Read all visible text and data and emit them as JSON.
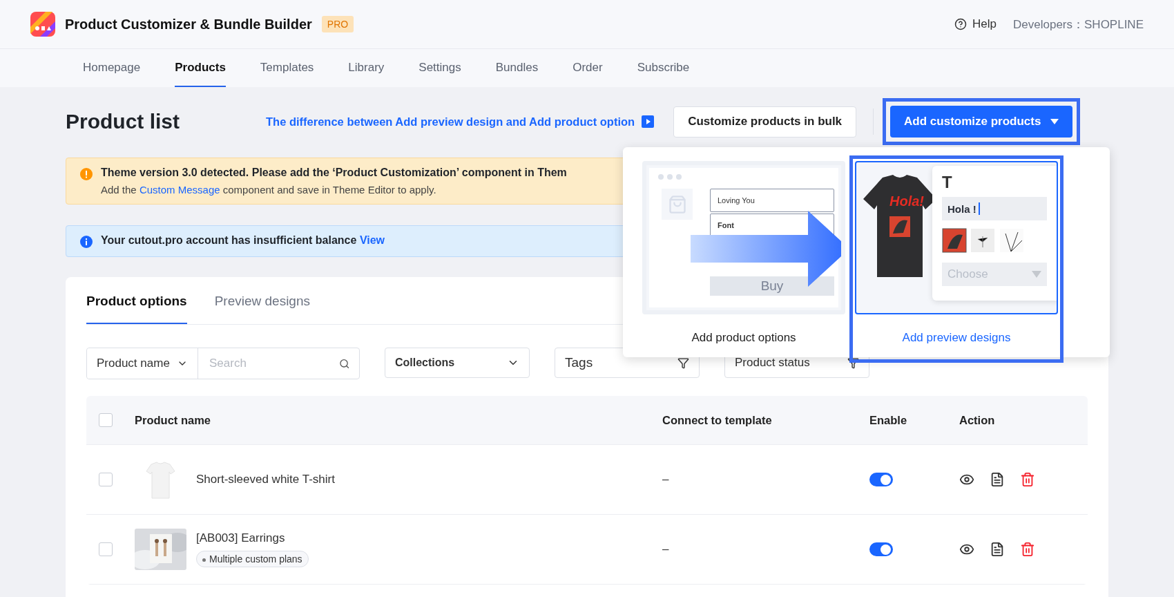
{
  "app": {
    "title": "Product Customizer & Bundle Builder",
    "badge": "PRO",
    "help": "Help",
    "developer": "Developers：SHOPLINE"
  },
  "nav": [
    {
      "label": "Homepage",
      "selected": false
    },
    {
      "label": "Products",
      "selected": true
    },
    {
      "label": "Templates",
      "selected": false
    },
    {
      "label": "Library",
      "selected": false
    },
    {
      "label": "Settings",
      "selected": false
    },
    {
      "label": "Bundles",
      "selected": false
    },
    {
      "label": "Order",
      "selected": false
    },
    {
      "label": "Subscribe",
      "selected": false
    }
  ],
  "page": {
    "title": "Product list",
    "help_link": "The difference between Add preview design and Add product option",
    "bulk_button": "Customize products in bulk",
    "add_button": {
      "label": "Add customize products",
      "highlighted": true
    }
  },
  "dropdown": {
    "options": [
      {
        "kind": "options",
        "label": "Add product options",
        "highlighted": false,
        "mock": {
          "field_1": "Loving You",
          "field_2": "Font",
          "button": "Buy"
        }
      },
      {
        "kind": "preview",
        "label": "Add preview designs",
        "highlighted": true,
        "mock": {
          "shirt_text": "Hola!",
          "heading": "T",
          "input": "Hola !",
          "select": "Choose"
        }
      }
    ]
  },
  "alerts": [
    {
      "kind": "warning",
      "title": "Theme version 3.0 detected. Please add the ‘Product Customization’ component in Them",
      "before": "Add the ",
      "link": "Custom Message",
      "after": " component and save in Theme Editor to apply."
    },
    {
      "kind": "info",
      "title": "Your cutout.pro account has insufficient balance",
      "link": "View"
    }
  ],
  "tabs": [
    {
      "label": "Product options",
      "selected": true
    },
    {
      "label": "Preview designs",
      "selected": false
    }
  ],
  "filters": {
    "field": "Product name",
    "search_placeholder": "Search",
    "collections": "Collections",
    "tags": "Tags",
    "status": "Product status"
  },
  "table": {
    "select_all_checked": false,
    "columns": [
      "Product name",
      "Connect to template",
      "Enable",
      "Action"
    ],
    "rows": [
      {
        "checked": false,
        "name": "Short-sleeved white T-shirt",
        "template": "–",
        "enabled": true
      },
      {
        "checked": false,
        "name": "[AB003] Earrings",
        "tag": "Multiple custom plans",
        "template": "–",
        "enabled": true
      }
    ]
  }
}
